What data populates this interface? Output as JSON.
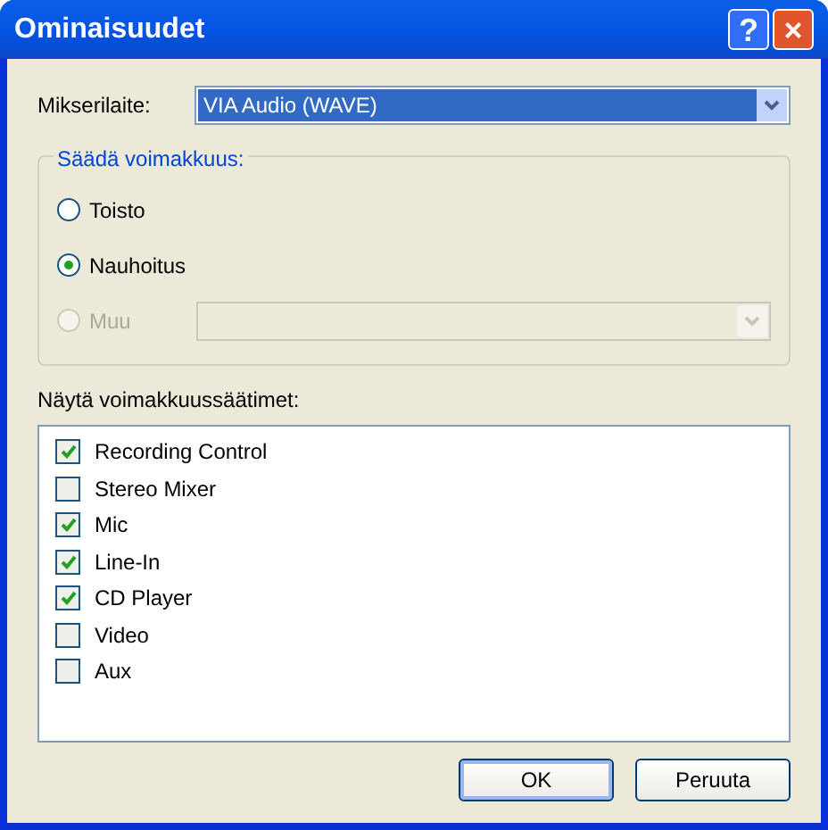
{
  "window": {
    "title": "Ominaisuudet",
    "buttons": [
      {
        "kind": "help",
        "label": "?"
      },
      {
        "kind": "close",
        "label": "×"
      }
    ]
  },
  "mixer": {
    "label": "Mikserilaite:",
    "value": "VIA Audio (WAVE)"
  },
  "volume_group": {
    "title": "Säädä voimakkuus:",
    "options": [
      {
        "label": "Toisto",
        "selected": false,
        "disabled": false
      },
      {
        "label": "Nauhoitus",
        "selected": true,
        "disabled": false
      },
      {
        "label": "Muu",
        "selected": false,
        "disabled": true
      }
    ]
  },
  "controls_label": "Näytä voimakkuussäätimet:",
  "controls": [
    {
      "label": "Recording Control",
      "checked": true
    },
    {
      "label": "Stereo Mixer",
      "checked": false
    },
    {
      "label": "Mic",
      "checked": true
    },
    {
      "label": "Line-In",
      "checked": true
    },
    {
      "label": "CD Player",
      "checked": true
    },
    {
      "label": "Video",
      "checked": false
    },
    {
      "label": "Aux",
      "checked": false
    }
  ],
  "buttons": [
    {
      "label": "OK",
      "default": true
    },
    {
      "label": "Peruuta",
      "default": false
    }
  ]
}
